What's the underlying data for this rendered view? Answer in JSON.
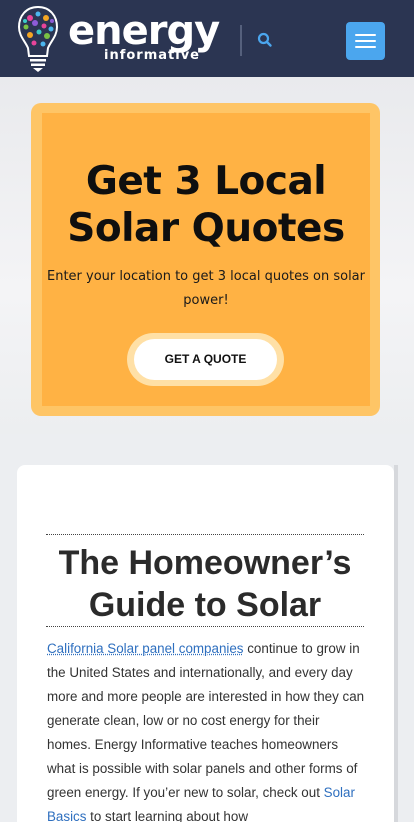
{
  "header": {
    "logo_word": "energy",
    "logo_sub": "informative",
    "search_icon": "search-icon",
    "menu_icon": "hamburger-menu-icon",
    "colors": {
      "background": "#2b3552",
      "menu_button": "#4ba6ee",
      "search_icon": "#4ba6ee"
    }
  },
  "promo": {
    "title": "Get 3 Local Solar Quotes",
    "text": "Enter your location to get 3 local quotes on solar power!",
    "button_label": "GET A QUOTE",
    "colors": {
      "panel": "#ffb244",
      "panel_border": "#fec566"
    }
  },
  "article": {
    "title": "The Homeowner’s Guide to Solar",
    "link1": "California Solar panel companies",
    "text1": " continue to grow in the United States and internationally, and every day more and more people are interested in how they can generate clean, low or no cost energy for their homes. Energy Informative teaches homeowners what is possible with solar panels and other forms of green energy. If you’er new to solar, check out ",
    "link2": "Solar Basics",
    "text2": " to start learning about how"
  }
}
